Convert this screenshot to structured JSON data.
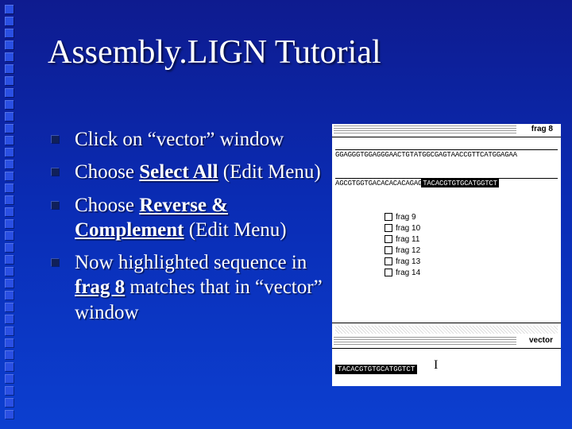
{
  "title": "Assembly.LIGN Tutorial",
  "bullets": {
    "b1": {
      "text": "Click on “vector” window"
    },
    "b2": {
      "pre": "Choose ",
      "strong": "Select All",
      "post": " (Edit Menu)"
    },
    "b3": {
      "pre": "Choose ",
      "strong": "Reverse & Complement",
      "post": " (Edit Menu)"
    },
    "b4": {
      "pre": "Now highlighted sequence in ",
      "strong": "frag 8",
      "post": " matches that in “vector” window"
    }
  },
  "app": {
    "win1_title": "frag 8",
    "seq_row1": "GGAGGGTGGAGGGAACTGTATGGCGAGTAACCGTTCATGGAGAA",
    "seq_row2_plain": "AGCGTGGTGACACACACAGAG",
    "seq_row2_highlight": "TACACGTGTGCATGGTCT",
    "frags": [
      "frag 9",
      "frag 10",
      "frag 11",
      "frag 12",
      "frag 13",
      "frag 14"
    ],
    "win2_title": "vector",
    "vector_seq": "TACACGTGTGCATGGTCT",
    "cursor_glyph": "I"
  }
}
